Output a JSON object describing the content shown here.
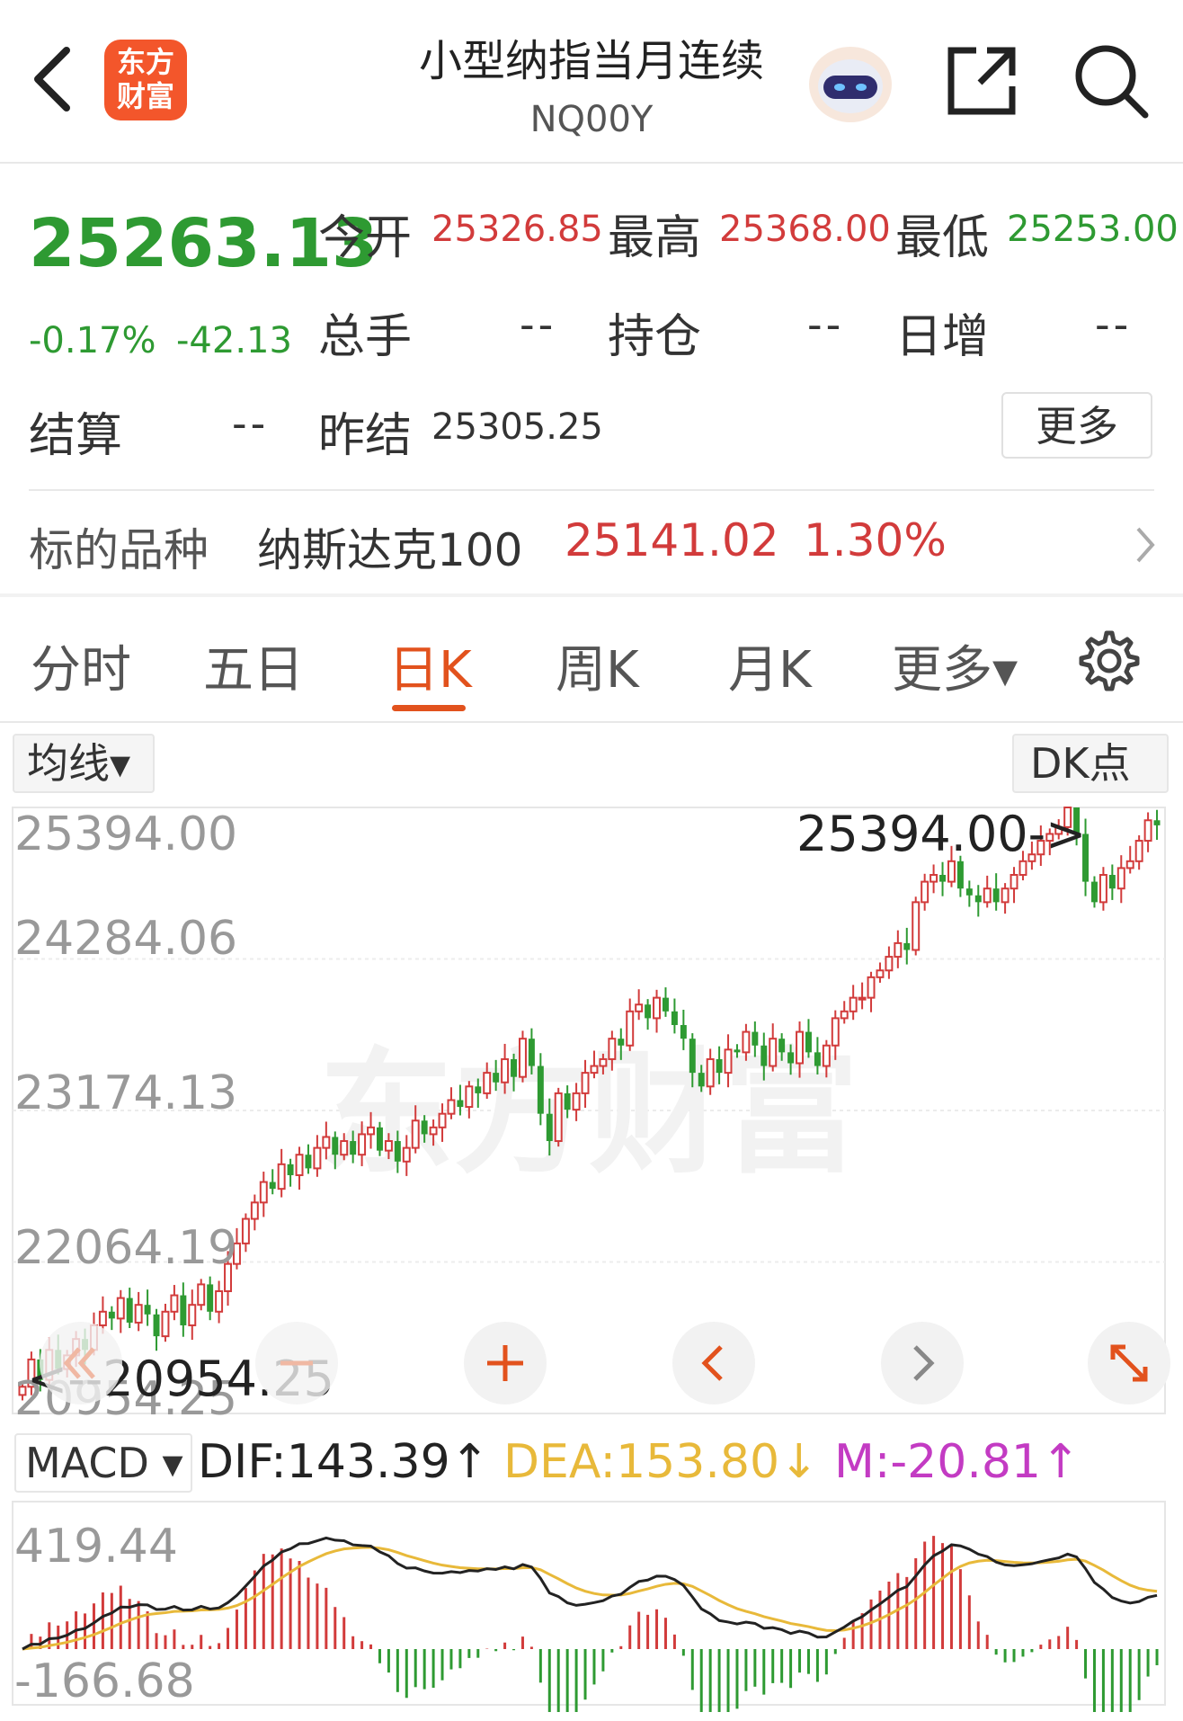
{
  "header": {
    "back_icon": "chevron-left-icon",
    "logo_line1": "东方",
    "logo_line2": "财富",
    "title": "小型纳指当月连续",
    "code": "NQ00Y",
    "avatar_icon": "robot-assistant-icon",
    "share_icon": "share-icon",
    "search_icon": "search-icon"
  },
  "quote": {
    "price": "25263.13",
    "change_pct": "-0.17%",
    "change_abs": "-42.13",
    "open_label": "今开",
    "open_value": "25326.85",
    "high_label": "最高",
    "high_value": "25368.00",
    "low_label": "最低",
    "low_value": "25253.00",
    "volume_label": "总手",
    "volume_value": "--",
    "position_label": "持仓",
    "position_value": "--",
    "daily_inc_label": "日增",
    "daily_inc_value": "--",
    "settle_label": "结算",
    "settle_value": "--",
    "prev_settle_label": "昨结",
    "prev_settle_value": "25305.25",
    "more_label": "更多"
  },
  "underlying": {
    "label": "标的品种",
    "name": "纳斯达克100",
    "price": "25141.02",
    "pct": "1.30%"
  },
  "tabs": [
    {
      "label": "分时"
    },
    {
      "label": "五日"
    },
    {
      "label": "日K"
    },
    {
      "label": "周K"
    },
    {
      "label": "月K"
    },
    {
      "label": "更多▾"
    }
  ],
  "settings_icon": "gear-icon",
  "chart_toolbar": {
    "ma_label": "均线▾",
    "dk_label": "DK点"
  },
  "colors": {
    "up": "#d23b3b",
    "down": "#2e9a32",
    "accent": "#e2521d",
    "dif": "#222222",
    "dea": "#e8b93a",
    "m": "#c33bc3"
  },
  "watermark": "东方财富",
  "chart_data": [
    {
      "type": "candlestick",
      "y_ticks": [
        "25394.00",
        "24284.06",
        "23174.13",
        "22064.19",
        "20954.25"
      ],
      "ylim": [
        20954.25,
        25394.0
      ],
      "max_marker": "25394.00->",
      "min_marker": "<--20954.25",
      "closes": [
        21150,
        21350,
        21200,
        21420,
        21280,
        21380,
        21500,
        21420,
        21600,
        21700,
        21650,
        21800,
        21620,
        21750,
        21680,
        21520,
        21700,
        21820,
        21600,
        21750,
        21900,
        21700,
        21850,
        22050,
        22200,
        22380,
        22500,
        22650,
        22600,
        22780,
        22700,
        22850,
        22750,
        22900,
        22980,
        22850,
        22950,
        22850,
        23000,
        23050,
        22880,
        22950,
        22800,
        22900,
        23100,
        23000,
        23050,
        23150,
        23250,
        23200,
        23350,
        23300,
        23450,
        23380,
        23550,
        23420,
        23700,
        23500,
        23150,
        22950,
        23300,
        23180,
        23300,
        23450,
        23500,
        23550,
        23700,
        23650,
        23900,
        23950,
        23850,
        24000,
        23900,
        23800,
        23700,
        23450,
        23350,
        23550,
        23450,
        23620,
        23600,
        23750,
        23650,
        23500,
        23700,
        23600,
        23520,
        23750,
        23600,
        23500,
        23650,
        23850,
        23900,
        24000,
        24000,
        24150,
        24200,
        24300,
        24400,
        24350,
        24700,
        24850,
        24900,
        24850,
        25000,
        24800,
        24750,
        24700,
        24800,
        24700,
        24800,
        24900,
        25000,
        25050,
        25150,
        25200,
        25250,
        25394,
        25200,
        24850,
        24700,
        24900,
        24800,
        24950,
        25000,
        25150,
        25300,
        25263
      ],
      "indicator_bar": [
        "MACD ▾"
      ],
      "macd": {
        "dif_label": "DIF:143.39↑",
        "dea_label": "DEA:153.80↓",
        "m_label": "M:-20.81↑",
        "y_ticks": [
          "419.44",
          "-166.68"
        ],
        "ylim": [
          -166.68,
          419.44
        ]
      }
    }
  ],
  "controls": {
    "double_left_icon": "double-chevron-left-icon",
    "zoom_out_icon": "minus-icon",
    "zoom_in_icon": "plus-icon",
    "prev_icon": "chevron-left-icon",
    "next_icon": "chevron-right-icon",
    "fullscreen_icon": "expand-icon"
  }
}
